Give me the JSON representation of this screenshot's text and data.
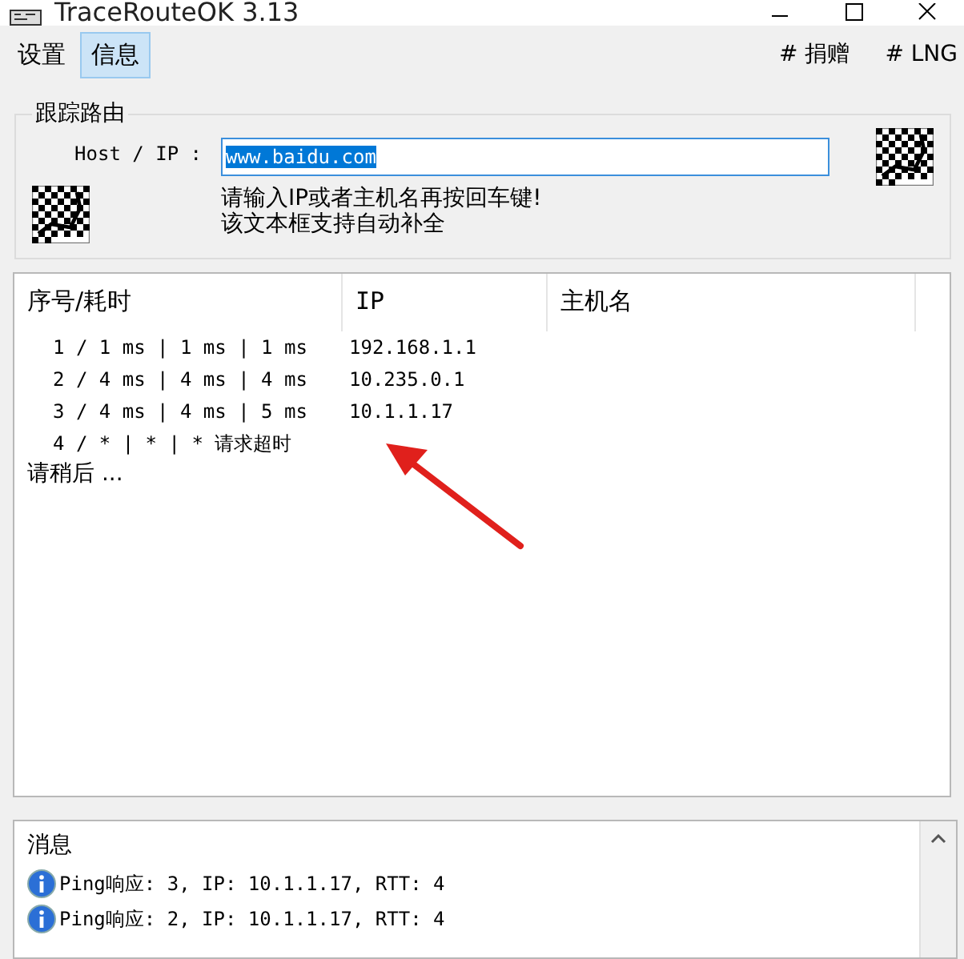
{
  "window": {
    "title": "TraceRouteOK 3.13"
  },
  "menu": [
    {
      "label": "设置",
      "selected": false
    },
    {
      "label": "信息",
      "selected": true
    }
  ],
  "menu_right": [
    "# 捐赠",
    "# LNG"
  ],
  "group": {
    "title": "跟踪路由",
    "host_label": "Host / IP :",
    "host_value": "www.baidu.com",
    "hint": "请输入IP或者主机名再按回车键!",
    "hint2": "该文本框支持自动补全"
  },
  "table": {
    "columns": [
      "序号/耗时",
      "IP",
      "主机名"
    ],
    "rows": [
      {
        "hop": "1 / 1 ms | 1 ms | 1 ms",
        "ip": "192.168.1.1"
      },
      {
        "hop": "2 / 4 ms | 4 ms | 4 ms",
        "ip": "10.235.0.1"
      },
      {
        "hop": "3 / 4 ms | 4 ms | 5 ms",
        "ip": "10.1.1.17"
      },
      {
        "hop": "4 / * | * | * 请求超时",
        "ip": ""
      }
    ],
    "status": "请稍后 ..."
  },
  "messages": {
    "title": "消息",
    "items": [
      "Ping响应: 3, IP: 10.1.1.17, RTT: 4",
      "Ping响应: 2, IP: 10.1.1.17, RTT: 4"
    ]
  }
}
